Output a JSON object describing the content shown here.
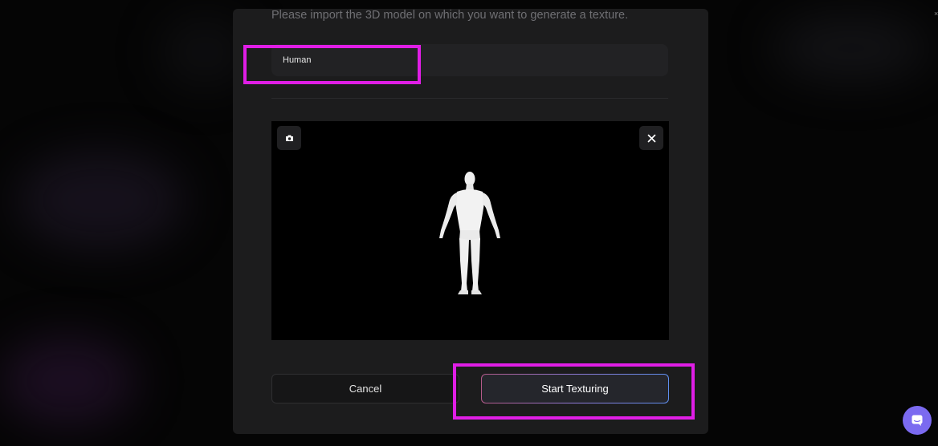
{
  "dialog": {
    "subtitle": "Please import the 3D model on which you want to generate a texture.",
    "model_field": {
      "value": "Human"
    },
    "preview": {
      "camera_icon": "camera-icon",
      "close_icon": "close-icon",
      "model_figure": "human-body-model"
    },
    "buttons": {
      "cancel_label": "Cancel",
      "start_label": "Start Texturing"
    }
  },
  "highlight_color": "#e01ee6",
  "accent_colors": {
    "start_border_gradient": [
      "#b45a8a",
      "#8e7ad6",
      "#5f8ff0"
    ],
    "chat_launcher": "#7b6af0"
  },
  "chat_launcher_icon": "chat-icon"
}
